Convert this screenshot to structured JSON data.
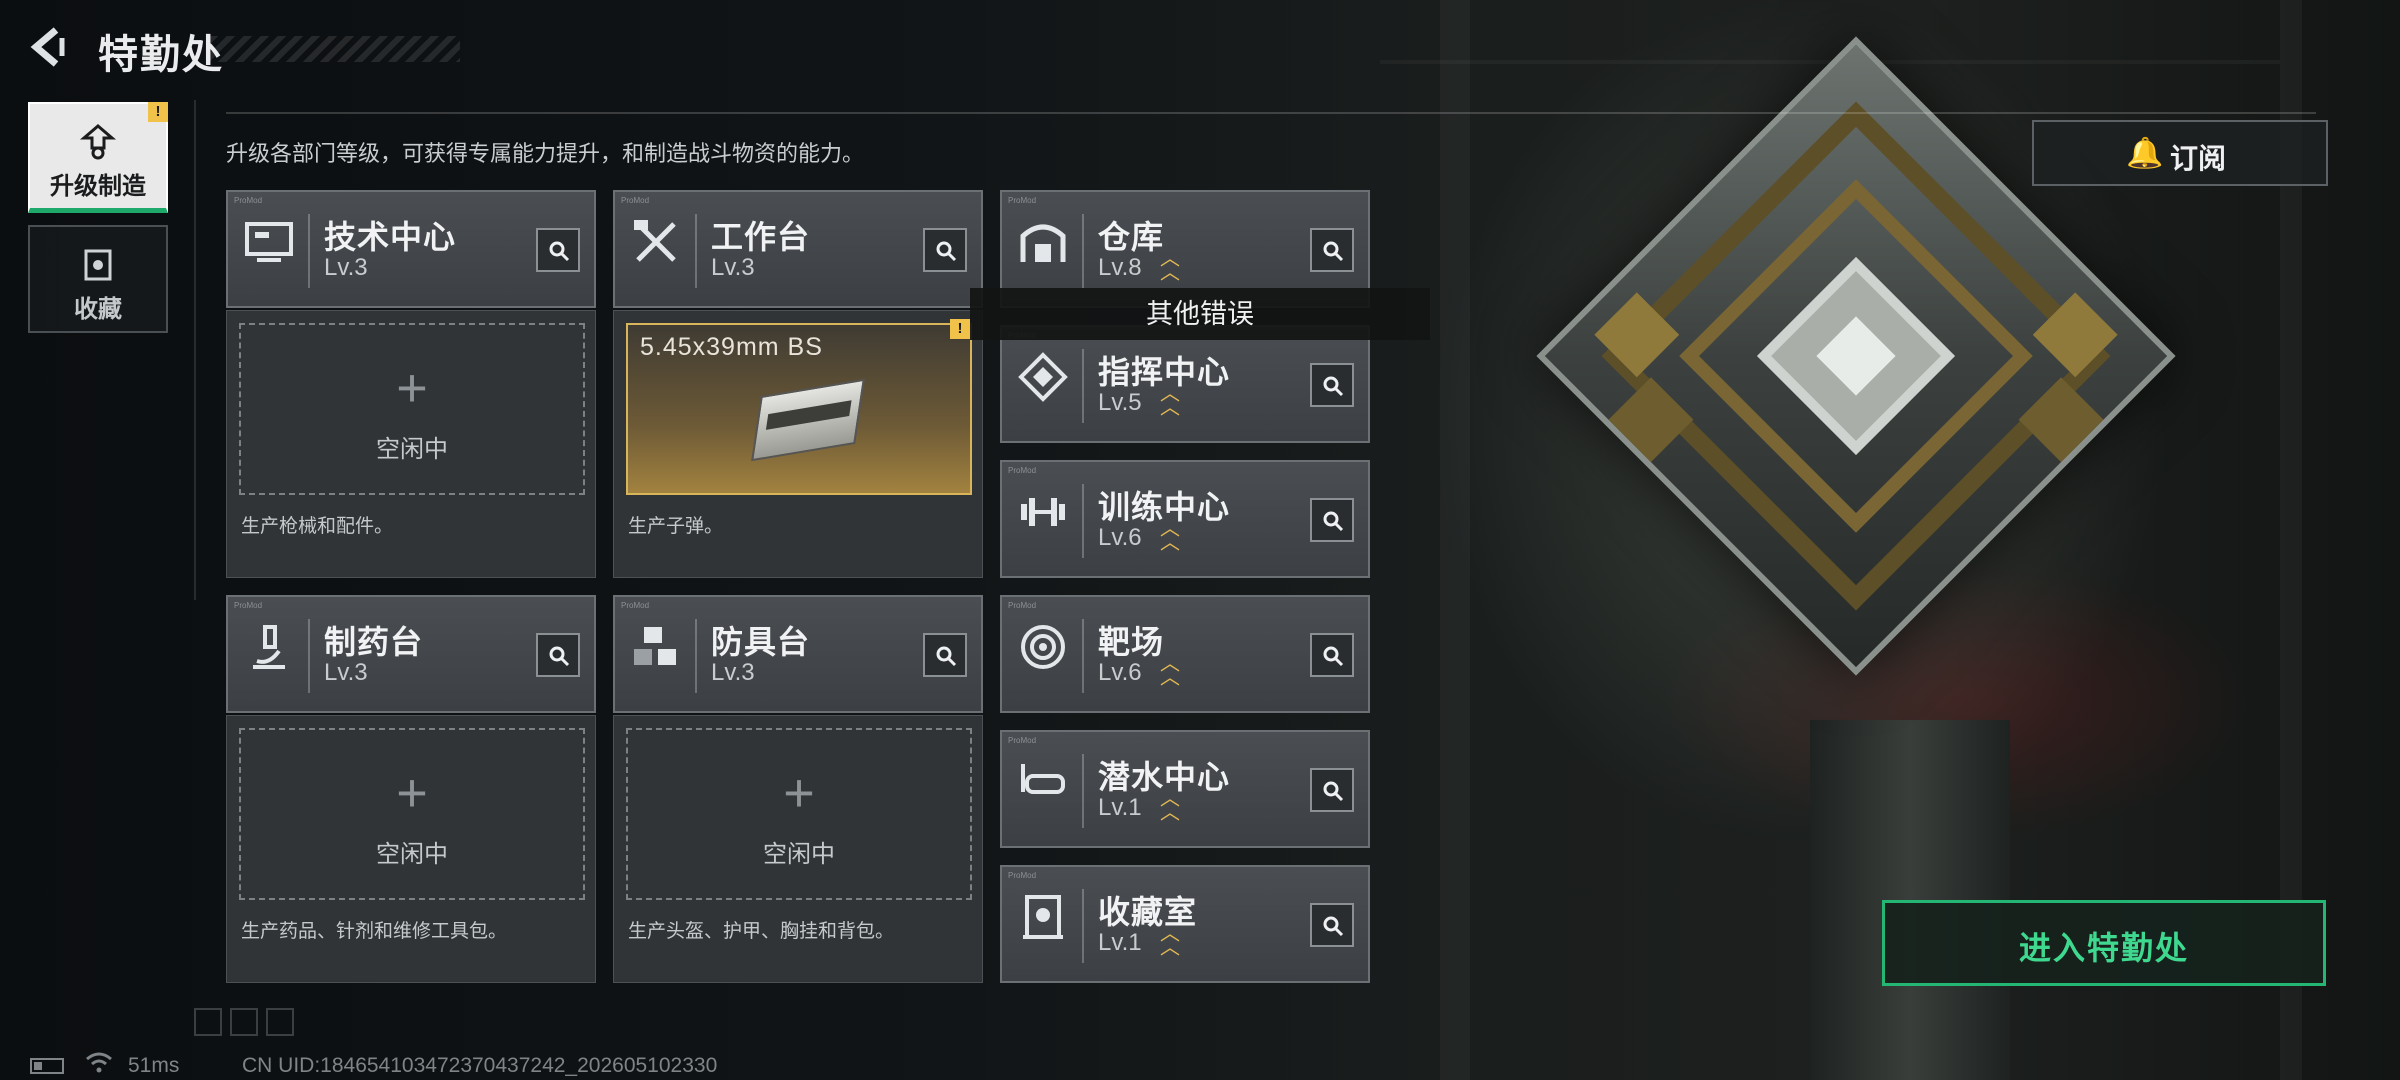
{
  "page": {
    "title": "特勤处",
    "description": "升级各部门等级，可获得专属能力提升，和制造战斗物资的能力。"
  },
  "side_nav": [
    {
      "label": "升级制造",
      "icon": "upgrade-icon",
      "active": true,
      "alert": "!"
    },
    {
      "label": "收藏",
      "icon": "collection-icon",
      "active": false
    }
  ],
  "subscribe": {
    "label": "订阅",
    "icon": "bell-icon"
  },
  "departments": {
    "tech_center": {
      "name": "技术中心",
      "level": "Lv.3",
      "icon": "computer-icon"
    },
    "workbench": {
      "name": "工作台",
      "level": "Lv.3",
      "icon": "hammer-wrench-icon"
    },
    "warehouse": {
      "name": "仓库",
      "level": "Lv.8",
      "icon": "warehouse-icon",
      "upgrade_available": true
    },
    "command_center": {
      "name": "指挥中心",
      "level": "Lv.5",
      "icon": "command-icon",
      "upgrade_available": true
    },
    "training_center": {
      "name": "训练中心",
      "level": "Lv.6",
      "icon": "dumbbell-icon",
      "upgrade_available": true
    },
    "pharmacy": {
      "name": "制药台",
      "level": "Lv.3",
      "icon": "microscope-icon"
    },
    "armor_bench": {
      "name": "防具台",
      "level": "Lv.3",
      "icon": "cubes-icon"
    },
    "shooting_range": {
      "name": "靶场",
      "level": "Lv.6",
      "icon": "target-icon",
      "upgrade_available": true
    },
    "diving_center": {
      "name": "潜水中心",
      "level": "Lv.1",
      "icon": "goggles-icon",
      "upgrade_available": true
    },
    "collection_room": {
      "name": "收藏室",
      "level": "Lv.1",
      "icon": "trophy-case-icon",
      "upgrade_available": true
    }
  },
  "production": {
    "tech_center": {
      "status": "空闲中",
      "description": "生产枪械和配件。"
    },
    "workbench": {
      "item_name": "5.45x39mm BS",
      "alert": "!",
      "description": "生产子弹。"
    },
    "pharmacy": {
      "status": "空闲中",
      "description": "生产药品、针剂和维修工具包。"
    },
    "armor_bench": {
      "status": "空闲中",
      "description": "生产头盔、护甲、胸挂和背包。"
    }
  },
  "error_tooltip": "其他错误",
  "enter_button": "进入特勤处",
  "status_bar": {
    "ping": "51ms",
    "uid": "CN UID:1846541034723704372​42_202605102330"
  },
  "colors": {
    "accent_green": "#24b673",
    "upgrade_gold": "#e3b852",
    "alert_yellow": "#f0c24a"
  }
}
